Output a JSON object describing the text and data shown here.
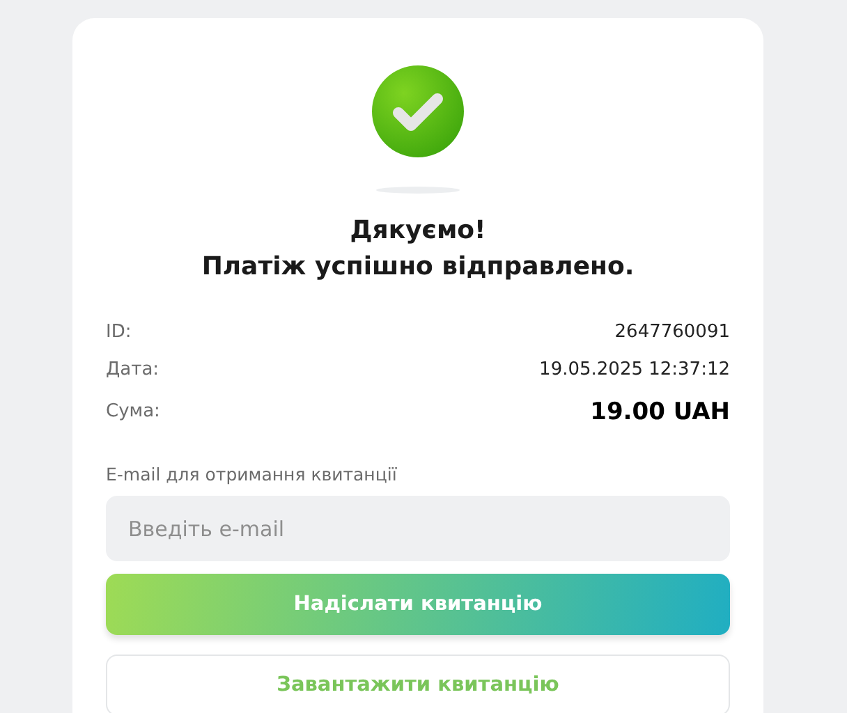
{
  "title_lines": [
    "Дякуємо!",
    "Платіж успішно відправлено."
  ],
  "details": [
    {
      "label": "ID:",
      "value": "2647760091",
      "kind": "plain"
    },
    {
      "label": "Дата:",
      "value": "19.05.2025 12:37:12",
      "kind": "plain"
    },
    {
      "label": "Сума:",
      "value": "19.00 UAH",
      "kind": "amount"
    }
  ],
  "email": {
    "label": "E-mail для отримання квитанції",
    "placeholder": "Введіть e-mail"
  },
  "buttons": [
    {
      "label": "Надіслати квитанцію",
      "kind": "primary"
    },
    {
      "label": "Завантажити квитанцію",
      "kind": "outline"
    }
  ]
}
